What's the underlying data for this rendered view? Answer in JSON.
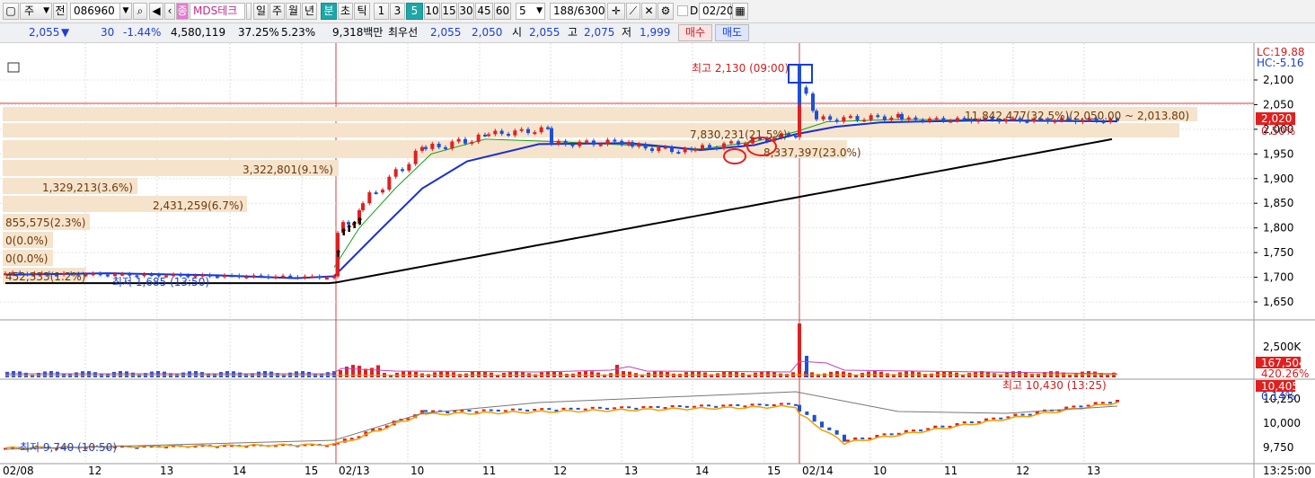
{
  "toolbar": {
    "market": "주",
    "board": "전",
    "code": "086960",
    "name_badge": "종",
    "name": "MDS테크",
    "periods": [
      "일",
      "주",
      "월",
      "년"
    ],
    "unit_toggle": [
      "분",
      "초",
      "틱"
    ],
    "intervals": [
      "1",
      "3",
      "5",
      "10",
      "15",
      "30",
      "45",
      "60"
    ],
    "custom_interval": "5",
    "count": "188/6300",
    "date_checkbox_label": "D",
    "date": "02/20"
  },
  "quote": {
    "price": "2,055",
    "change": "30",
    "change_pct": "-1.44%",
    "volume": "4,580,119",
    "volume_ratio": "37.25%",
    "turnover": "5.23%",
    "amount": "9,318백만",
    "best_label": "최우선",
    "ask": "2,055",
    "bid": "2,050",
    "open_label": "시",
    "open": "2,055",
    "high_label": "고",
    "high": "2,075",
    "low_label": "저",
    "low": "1,999",
    "buy_label": "매수",
    "sell_label": "매도"
  },
  "chart": {
    "lc_label": "LC:19.88",
    "hc_label": "HC:-5.16",
    "price_ticks": [
      "2,100",
      "2,050",
      "2,020",
      "2,000",
      "1,950",
      "1,900",
      "1,850",
      "1,800",
      "1,750",
      "1,700",
      "1,650"
    ],
    "current_price": "2,020",
    "current_pct": "0.50%",
    "max_note": "최고 2,130 (09:00)",
    "min_note": "최저 1,685 (13:50)",
    "profile_labels": [
      "11,842,477(32.5%)(2,050.00 ~ 2,013.80)",
      "7,830,231(21.5%)",
      "8,337,397(23.0%)",
      "3,322,801(9.1%)",
      "1,329,213(3.6%)",
      "2,431,259(6.7%)",
      "855,575(2.3%)",
      "0(0.0%)",
      "0(0.0%)",
      "452,333(1.2%)"
    ],
    "volume_ticks": [
      "2,500K"
    ],
    "volume_current": "167,504",
    "volume_pct": "420.26%",
    "index_current": "10,405",
    "index_pct": "0.14%",
    "index_ticks": [
      "10,250",
      "10,000",
      "9,750"
    ],
    "index_max_note": "최고 10,430 (13:25)",
    "index_min_note": "최저 9,740 (10:50)",
    "x_ticks": [
      "02/08",
      "12",
      "13",
      "14",
      "15",
      "02/13",
      "10",
      "11",
      "12",
      "13",
      "14",
      "15",
      "02/14",
      "10",
      "11",
      "12",
      "13"
    ],
    "time": "13:25:00",
    "colors": {
      "up": "#e02020",
      "down": "#1f4fd6",
      "ma_short": "#18a018",
      "ma_mid": "#1a2fd0",
      "ma_long": "#000000",
      "profile": "#f6e3cc",
      "label": "#6b3a0a"
    }
  }
}
